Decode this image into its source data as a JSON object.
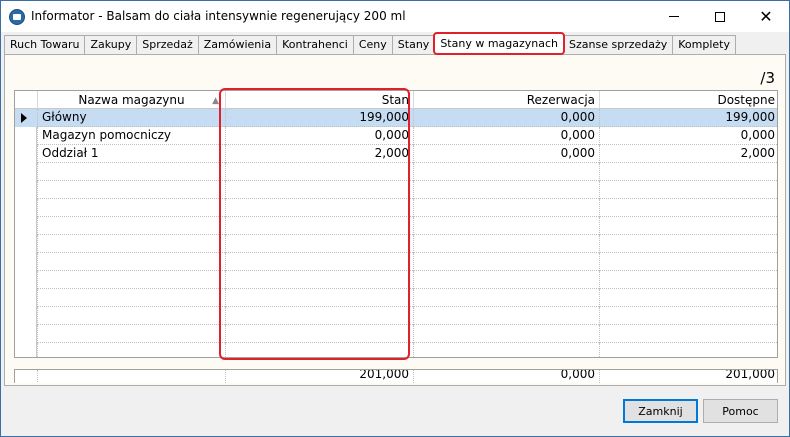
{
  "window": {
    "title": "Informator - Balsam do ciała intensywnie regenerujący 200 ml",
    "close_glyph": "✕"
  },
  "tabs": [
    {
      "label": "Ruch Towaru",
      "active": false
    },
    {
      "label": "Zakupy",
      "active": false
    },
    {
      "label": "Sprzedaż",
      "active": false
    },
    {
      "label": "Zamówienia",
      "active": false
    },
    {
      "label": "Kontrahenci",
      "active": false
    },
    {
      "label": "Ceny",
      "active": false
    },
    {
      "label": "Stany",
      "active": false
    },
    {
      "label": "Stany w magazynach",
      "active": true
    },
    {
      "label": "Szanse sprzedaży",
      "active": false
    },
    {
      "label": "Komplety",
      "active": false
    }
  ],
  "page": {
    "record_counter": "/3"
  },
  "grid": {
    "columns": [
      "Nazwa magazynu",
      "Stan",
      "Rezerwacja",
      "Dostępne"
    ],
    "rows": [
      {
        "name": "Główny",
        "stan": "199,000",
        "rezerwacja": "0,000",
        "dostepne": "199,000",
        "selected": true
      },
      {
        "name": "Magazyn pomocniczy",
        "stan": "0,000",
        "rezerwacja": "0,000",
        "dostepne": "0,000",
        "selected": false
      },
      {
        "name": "Oddział 1",
        "stan": "2,000",
        "rezerwacja": "0,000",
        "dostepne": "2,000",
        "selected": false
      }
    ],
    "totals": {
      "stan": "201,000",
      "rezerwacja": "0,000",
      "dostepne": "201,000"
    }
  },
  "buttons": {
    "close": "Zamknij",
    "help": "Pomoc"
  },
  "colors": {
    "highlight": "#e0202a",
    "selected_row": "#c6dcf3",
    "tab_page_bg": "#fdfbf4"
  }
}
